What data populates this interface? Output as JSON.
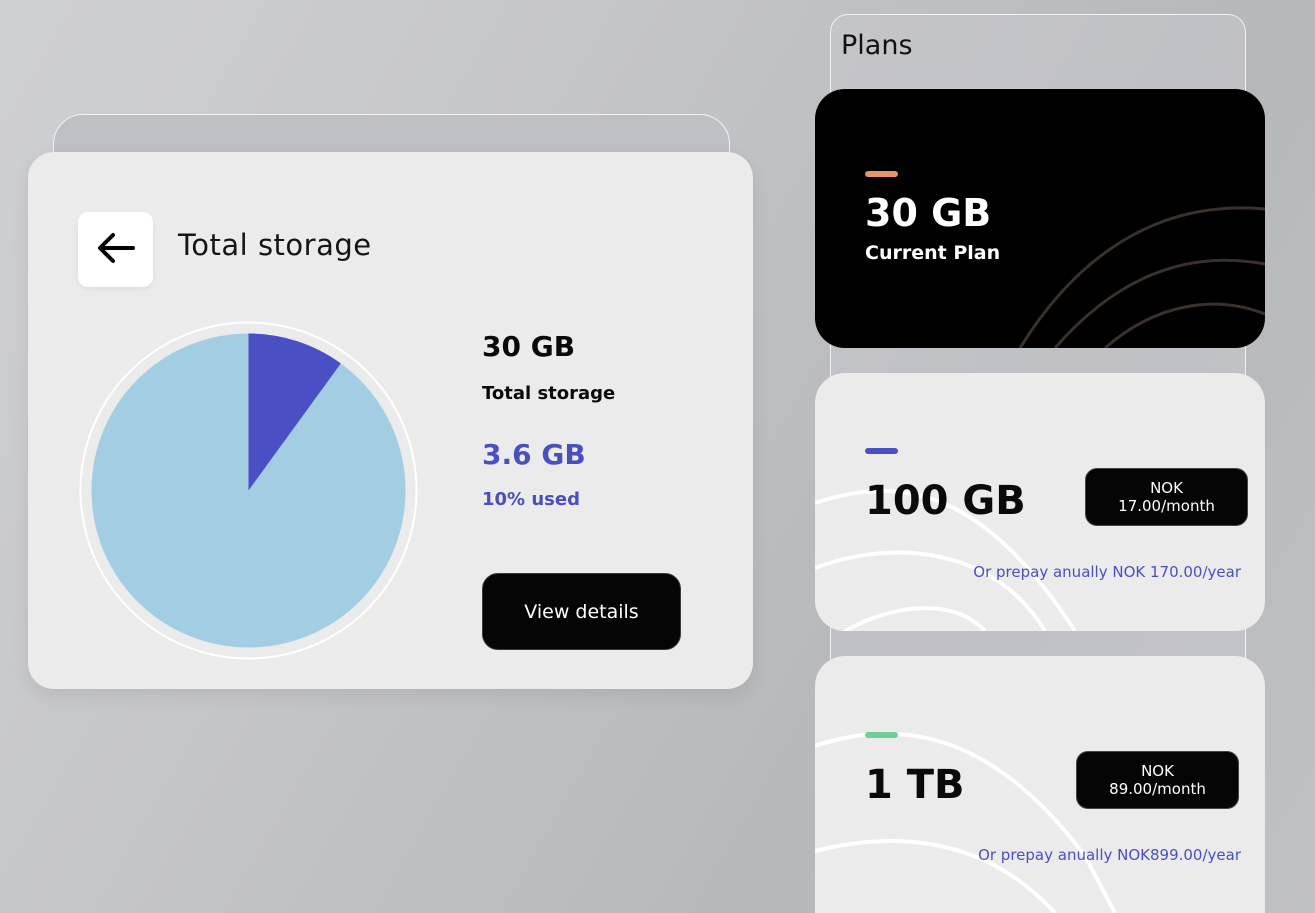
{
  "storage": {
    "title": "Total storage",
    "total_value": "30 GB",
    "total_label": "Total storage",
    "used_value": "3.6 GB",
    "used_label": "10% used",
    "used_fraction": 0.1,
    "view_details_label": "View details",
    "colors": {
      "used": "#4a4fc4",
      "free": "#a2cde3",
      "used_text": "#4a4fbd"
    }
  },
  "plans": {
    "title": "Plans",
    "current": {
      "size": "30 GB",
      "label": "Current Plan",
      "accent": "#e8936a"
    },
    "items": [
      {
        "size": "100 GB",
        "price": "NOK 17.00/month",
        "prepay": "Or prepay anually NOK 170.00/year",
        "accent": "#4a4fc4"
      },
      {
        "size": "1 TB",
        "price": "NOK 89.00/month",
        "prepay": "Or prepay anually NOK899.00/year",
        "accent": "#6fcf97"
      }
    ]
  },
  "icons": {
    "back": "arrow-left-icon"
  }
}
